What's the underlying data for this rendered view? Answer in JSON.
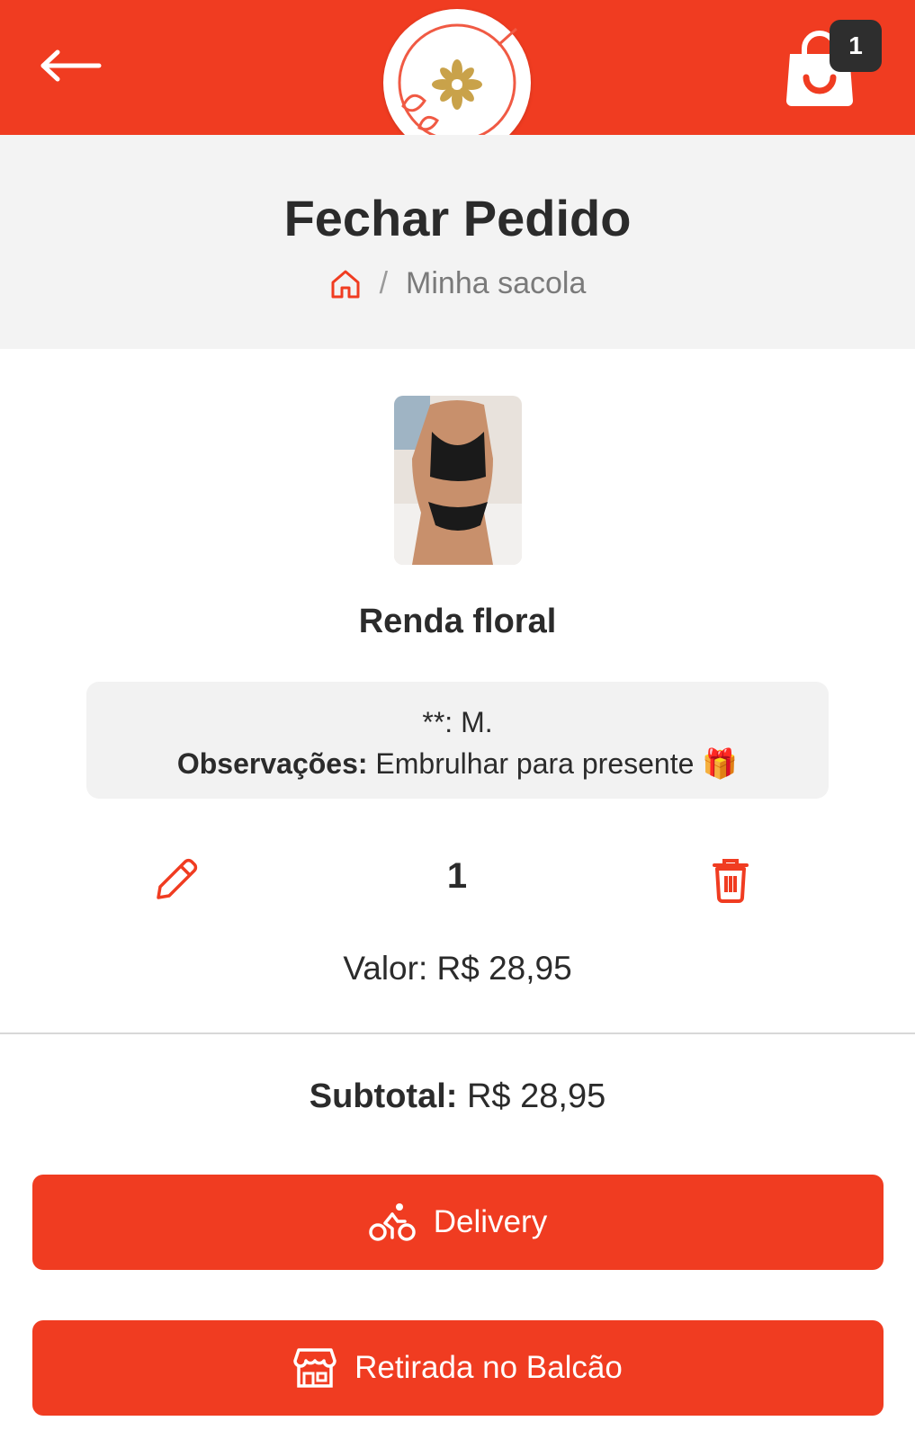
{
  "header": {
    "back_icon": "arrow-left-icon",
    "logo_icon": "beauty-boutique-logo",
    "cart_icon": "shopping-bag-icon",
    "cart_count": "1",
    "accent_color": "#f03c21"
  },
  "page": {
    "title": "Fechar Pedido",
    "breadcrumb": {
      "home_icon": "home-icon",
      "separator": "/",
      "current": "Minha sacola"
    }
  },
  "item": {
    "name": "Renda floral",
    "option_line": "**: M.",
    "notes_label": "Observações:",
    "notes_value": " Embrulhar para presente 🎁",
    "quantity": "1",
    "price_line": "Valor: R$ 28,95",
    "edit_icon": "pencil-icon",
    "delete_icon": "trash-icon"
  },
  "summary": {
    "subtotal_label": "Subtotal:",
    "subtotal_value": " R$ 28,95"
  },
  "actions": {
    "delivery_label": "Delivery",
    "delivery_icon": "bike-icon",
    "pickup_label": "Retirada no Balcão",
    "pickup_icon": "store-icon"
  }
}
